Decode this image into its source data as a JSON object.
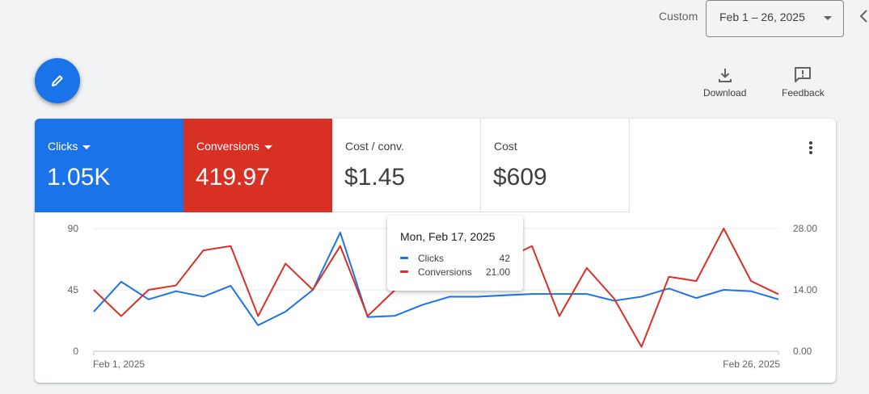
{
  "toolbar": {
    "range_type": "Custom",
    "date_range": "Feb 1 – 26, 2025",
    "download_label": "Download",
    "feedback_label": "Feedback"
  },
  "metrics": [
    {
      "label": "Clicks",
      "value": "1.05K",
      "color": "#1a73e8",
      "selected": true
    },
    {
      "label": "Conversions",
      "value": "419.97",
      "color": "#d93025",
      "selected": true
    },
    {
      "label": "Cost / conv.",
      "value": "$1.45",
      "selected": false
    },
    {
      "label": "Cost",
      "value": "$609",
      "selected": false
    }
  ],
  "tooltip": {
    "title": "Mon, Feb 17, 2025",
    "rows": [
      {
        "name": "Clicks",
        "value": "42",
        "color": "#1a73e8"
      },
      {
        "name": "Conversions",
        "value": "21.00",
        "color": "#d93025"
      }
    ]
  },
  "chart_data": {
    "type": "line",
    "x": [
      "2025-02-01",
      "2025-02-02",
      "2025-02-03",
      "2025-02-04",
      "2025-02-05",
      "2025-02-06",
      "2025-02-07",
      "2025-02-08",
      "2025-02-09",
      "2025-02-10",
      "2025-02-11",
      "2025-02-12",
      "2025-02-13",
      "2025-02-14",
      "2025-02-15",
      "2025-02-16",
      "2025-02-17",
      "2025-02-18",
      "2025-02-19",
      "2025-02-20",
      "2025-02-21",
      "2025-02-22",
      "2025-02-23",
      "2025-02-24",
      "2025-02-25",
      "2025-02-26"
    ],
    "x_tick_labels": [
      "Feb 1, 2025",
      "Feb 26, 2025"
    ],
    "series": [
      {
        "name": "Clicks",
        "axis": "left",
        "color": "#1a73e8",
        "values": [
          29,
          51,
          38,
          44,
          40,
          48,
          19,
          29,
          45,
          87,
          25,
          26,
          34,
          40,
          40,
          41,
          42,
          42,
          42,
          37,
          40,
          46,
          39,
          45,
          44,
          38
        ]
      },
      {
        "name": "Conversions",
        "axis": "right",
        "color": "#d93025",
        "values": [
          14.0,
          8.0,
          14.0,
          15.0,
          23.0,
          24.0,
          8.0,
          20.0,
          14.0,
          24.0,
          8.0,
          14.0,
          14.0,
          14.0,
          15.0,
          21.0,
          24.0,
          8.0,
          19.0,
          12.0,
          1.0,
          17.0,
          16.0,
          28.0,
          16.0,
          13.0
        ]
      }
    ],
    "left_axis": {
      "ticks": [
        "90",
        "45",
        "0"
      ],
      "ylim": [
        0,
        90
      ]
    },
    "right_axis": {
      "ticks": [
        "28.00",
        "14.00",
        "0.00"
      ],
      "ylim": [
        0,
        28
      ]
    },
    "grid": true
  }
}
